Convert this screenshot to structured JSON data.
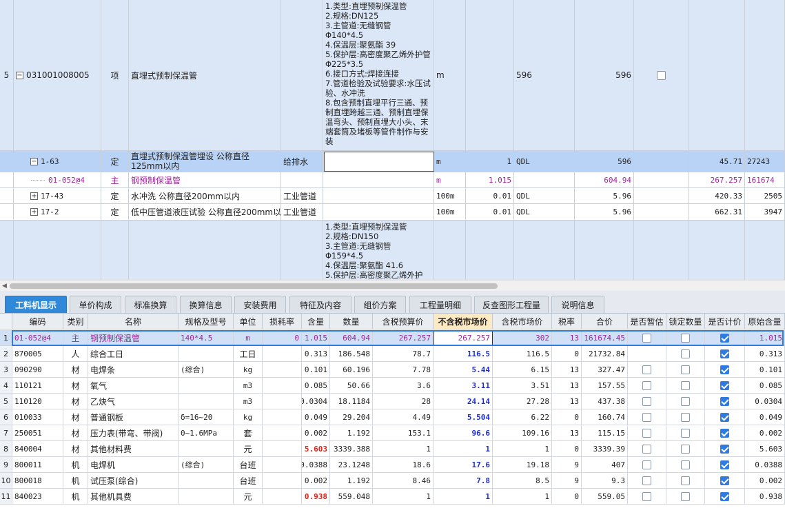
{
  "top_rows": {
    "r1": {
      "seq": "5",
      "code": "031001008005",
      "type": "项",
      "name": "直埋式预制保温管",
      "desc": "1.类型:直埋预制保温管\n2.规格:DN125\n3.主管道:无缝钢管\nΦ140*4.5\n4.保温层:聚氨酯 39\n5.保护层:高密度聚乙烯外护管 Φ225*3.5\n6.接口方式:焊接连接\n7.管道检验及试验要求:水压试验、水冲洗\n8.包含预制直埋平行三通、预制直埋跨越三通、预制直埋保温弯头、预制直埋大小头、末端套筒及堵板等管件制作与安装",
      "unit": "m",
      "qty_expr": "596",
      "qty": "596"
    },
    "r2": {
      "code": "1-63",
      "type": "定",
      "name": "直埋式预制保温管埋设 公称直径125mm以内",
      "spec": "给排水",
      "unit": "m",
      "qty_expr": "1",
      "qty_src": "QDL",
      "qty": "596",
      "price": "45.71",
      "total": "27243"
    },
    "r3": {
      "code": "01-052@4",
      "type": "主",
      "name": "钢预制保温管",
      "unit": "m",
      "qty_expr": "1.015",
      "qty": "604.94",
      "price": "267.257",
      "total": "161674"
    },
    "r4": {
      "code": "17-43",
      "type": "定",
      "name": "水冲洗 公称直径200mm以内",
      "spec": "工业管道",
      "unit": "100m",
      "qty_expr": "0.01",
      "qty_src": "QDL",
      "qty": "5.96",
      "price": "420.33",
      "total": "2505"
    },
    "r5": {
      "code": "17-2",
      "type": "定",
      "name": "低中压管道液压试验 公称直径200mm以内",
      "spec": "工业管道",
      "unit": "100m",
      "qty_expr": "0.01",
      "qty_src": "QDL",
      "qty": "5.96",
      "price": "662.31",
      "total": "3947"
    },
    "r6": {
      "desc": "1.类型:直埋预制保温管\n2.规格:DN150\n3.主管道:无缝钢管\nΦ159*4.5\n4.保温层:聚氨酯 41.6\n5.保护层:高密度聚乙烯外护"
    }
  },
  "tabs": [
    "工料机显示",
    "单价构成",
    "标准换算",
    "换算信息",
    "安装费用",
    "特征及内容",
    "组价方案",
    "工程量明细",
    "反查图形工程量",
    "说明信息"
  ],
  "columns": [
    "编码",
    "类别",
    "名称",
    "规格及型号",
    "单位",
    "损耗率",
    "含量",
    "数量",
    "含税预算价",
    "不含税市场价",
    "含税市场价",
    "税率",
    "合价",
    "是否暂估",
    "锁定数量",
    "是否计价",
    "原始含量"
  ],
  "rows": [
    {
      "n": "1",
      "code": "01-052@4",
      "cat": "主",
      "name": "钢预制保温管",
      "spec": "140*4.5",
      "unit": "m",
      "loss": "0",
      "content": "1.015",
      "qty": "604.94",
      "tax_budget": "267.257",
      "market_ex": "267.257",
      "market_in": "302",
      "rate": "13",
      "total": "161674.45",
      "est": false,
      "lock": false,
      "priced": true,
      "orig": "1.015"
    },
    {
      "n": "2",
      "code": "870005",
      "cat": "人",
      "name": "综合工日",
      "spec": "",
      "unit": "工日",
      "loss": "",
      "content": "0.313",
      "qty": "186.548",
      "tax_budget": "78.7",
      "market_ex": "116.5",
      "market_in": "116.5",
      "rate": "0",
      "total": "21732.84",
      "est": null,
      "lock": false,
      "priced": true,
      "orig": "0.313"
    },
    {
      "n": "3",
      "code": "090290",
      "cat": "材",
      "name": "电焊条",
      "spec": "(综合)",
      "unit": "kg",
      "loss": "",
      "content": "0.101",
      "qty": "60.196",
      "tax_budget": "7.78",
      "market_ex": "5.44",
      "market_in": "6.15",
      "rate": "13",
      "total": "327.47",
      "est": false,
      "lock": false,
      "priced": true,
      "orig": "0.101"
    },
    {
      "n": "4",
      "code": "110121",
      "cat": "材",
      "name": "氧气",
      "spec": "",
      "unit": "m3",
      "loss": "",
      "content": "0.085",
      "qty": "50.66",
      "tax_budget": "3.6",
      "market_ex": "3.11",
      "market_in": "3.51",
      "rate": "13",
      "total": "157.55",
      "est": false,
      "lock": false,
      "priced": true,
      "orig": "0.085"
    },
    {
      "n": "5",
      "code": "110120",
      "cat": "材",
      "name": "乙炔气",
      "spec": "",
      "unit": "m3",
      "loss": "",
      "content": "0.0304",
      "qty": "18.1184",
      "tax_budget": "28",
      "market_ex": "24.14",
      "market_in": "27.28",
      "rate": "13",
      "total": "437.38",
      "est": false,
      "lock": false,
      "priced": true,
      "orig": "0.0304"
    },
    {
      "n": "6",
      "code": "010033",
      "cat": "材",
      "name": "普通钢板",
      "spec": "δ=16~20",
      "unit": "kg",
      "loss": "",
      "content": "0.049",
      "qty": "29.204",
      "tax_budget": "4.49",
      "market_ex": "5.504",
      "market_in": "6.22",
      "rate": "0",
      "total": "160.74",
      "est": false,
      "lock": false,
      "priced": true,
      "orig": "0.049"
    },
    {
      "n": "7",
      "code": "250051",
      "cat": "材",
      "name": "压力表(带弯、带阀)",
      "spec": "0~1.6MPa",
      "unit": "套",
      "loss": "",
      "content": "0.002",
      "qty": "1.192",
      "tax_budget": "153.1",
      "market_ex": "96.6",
      "market_in": "109.16",
      "rate": "13",
      "total": "115.15",
      "est": false,
      "lock": false,
      "priced": true,
      "orig": "0.002"
    },
    {
      "n": "8",
      "code": "840004",
      "cat": "材",
      "name": "其他材料费",
      "spec": "",
      "unit": "元",
      "loss": "",
      "content": "5.603",
      "qty": "3339.388",
      "tax_budget": "1",
      "market_ex": "1",
      "market_in": "1",
      "rate": "0",
      "total": "3339.39",
      "est": false,
      "lock": false,
      "priced": true,
      "orig": "5.603",
      "content_red": true
    },
    {
      "n": "9",
      "code": "800011",
      "cat": "机",
      "name": "电焊机",
      "spec": "(综合)",
      "unit": "台班",
      "loss": "",
      "content": "0.0388",
      "qty": "23.1248",
      "tax_budget": "18.6",
      "market_ex": "17.6",
      "market_in": "19.18",
      "rate": "9",
      "total": "407",
      "est": false,
      "lock": false,
      "priced": true,
      "orig": "0.0388"
    },
    {
      "n": "10",
      "code": "800018",
      "cat": "机",
      "name": "试压泵(综合)",
      "spec": "",
      "unit": "台班",
      "loss": "",
      "content": "0.002",
      "qty": "1.192",
      "tax_budget": "8.46",
      "market_ex": "7.8",
      "market_in": "8.5",
      "rate": "9",
      "total": "9.3",
      "est": false,
      "lock": false,
      "priced": true,
      "orig": "0.002"
    },
    {
      "n": "11",
      "code": "840023",
      "cat": "机",
      "name": "其他机具费",
      "spec": "",
      "unit": "元",
      "loss": "",
      "content": "0.938",
      "qty": "559.048",
      "tax_budget": "1",
      "market_ex": "1",
      "market_in": "1",
      "rate": "0",
      "total": "559.05",
      "est": false,
      "lock": false,
      "priced": true,
      "orig": "0.938",
      "content_red": true
    }
  ],
  "colors": {
    "accent": "#2f89d8",
    "selected_row": "#cfe0f7",
    "purple_text": "#a0279a",
    "blue_value": "#1d2fd0",
    "red_value": "#e0241c"
  },
  "icons": {
    "expand": "plus-box-icon",
    "collapse": "minus-box-icon",
    "checkbox": "checkbox-icon",
    "scroll_left": "arrow-left-icon"
  }
}
